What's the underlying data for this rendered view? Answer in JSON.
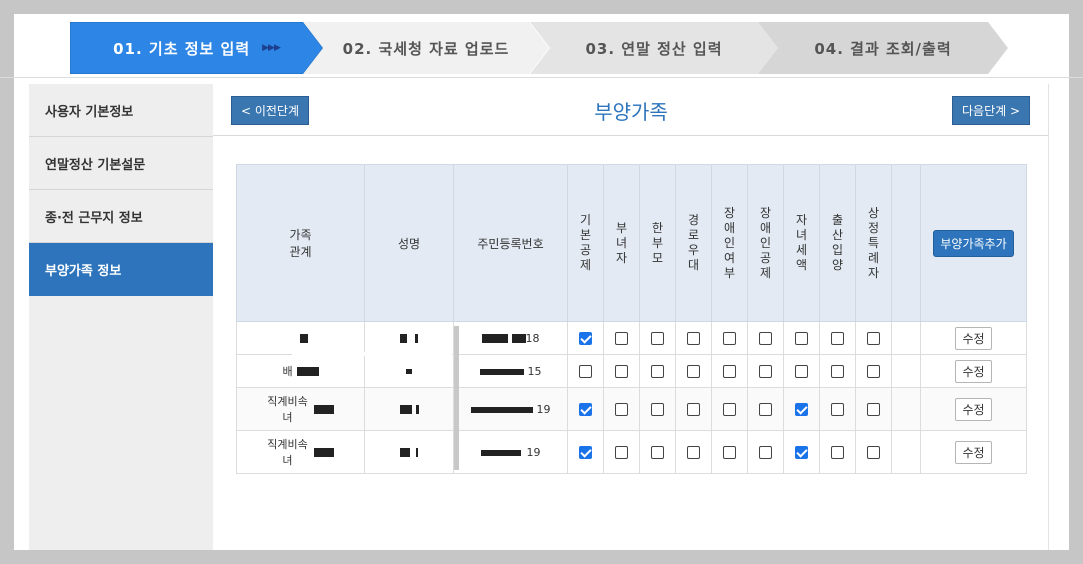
{
  "steps": [
    {
      "label": "01. 기초 정보 입력",
      "active": true,
      "marker": "▶▶▶"
    },
    {
      "label": "02. 국세청 자료 업로드"
    },
    {
      "label": "03. 연말 정산 입력"
    },
    {
      "label": "04. 결과 조회/출력"
    }
  ],
  "sidebar": {
    "items": [
      {
        "label": "사용자 기본정보"
      },
      {
        "label": "연말정산 기본설문"
      },
      {
        "label": "종·전 근무지 정보"
      },
      {
        "label": "부양가족 정보",
        "active": true
      }
    ]
  },
  "header": {
    "prev_label": "< 이전단계",
    "next_label": "다음단계 >",
    "title": "부양가족"
  },
  "table": {
    "headers": {
      "relation": "가족\n관계",
      "name": "성명",
      "rrn": "주민등록번호",
      "basic": "기본공제",
      "female": "부녀자",
      "single_parent": "한부모",
      "elderly": "경로우대",
      "disabled_yn": "장애인여부",
      "disabled_deduct": "장애인공제",
      "child_credit": "자녀세액",
      "birth_adopt": "출산입양",
      "taxpayer": "상정특례자",
      "add_button": "부양가족추가"
    },
    "rows": [
      {
        "relation": "",
        "rrn_suffix": "18",
        "checks": [
          true,
          false,
          false,
          false,
          false,
          false,
          false,
          false,
          false
        ],
        "edit": "수정"
      },
      {
        "relation": "배",
        "rrn_suffix": "15",
        "checks": [
          false,
          false,
          false,
          false,
          false,
          false,
          false,
          false,
          false
        ],
        "edit": "수정"
      },
      {
        "relation": "직계비속\n녀",
        "rrn_suffix": "19",
        "checks": [
          true,
          false,
          false,
          false,
          false,
          false,
          true,
          false,
          false
        ],
        "edit": "수정"
      },
      {
        "relation": "직계비속\n녀",
        "rrn_suffix": "19",
        "checks": [
          true,
          false,
          false,
          false,
          false,
          false,
          true,
          false,
          false
        ],
        "edit": "수정"
      }
    ]
  }
}
